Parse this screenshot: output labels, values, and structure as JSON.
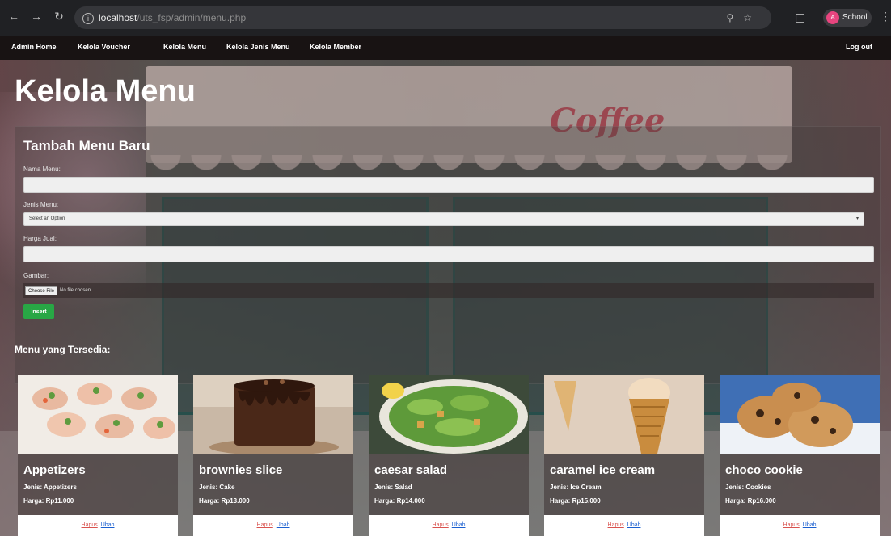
{
  "browser": {
    "url_host": "localhost",
    "url_path": "/uts_fsp/admin/menu.php",
    "profile_name": "School",
    "profile_initial": "A"
  },
  "nav": {
    "items": [
      {
        "label": "Admin Home"
      },
      {
        "label": "Kelola Voucher"
      },
      {
        "label": "Kelola Menu"
      },
      {
        "label": "Kelola Jenis Menu"
      },
      {
        "label": "Kelola Member"
      }
    ],
    "logout_label": "Log out"
  },
  "page": {
    "title": "Kelola Menu",
    "background_sign": "Coffee"
  },
  "form": {
    "heading": "Tambah Menu Baru",
    "nama_label": "Nama Menu:",
    "nama_value": "",
    "jenis_label": "Jenis Menu:",
    "jenis_selected": "Select an Option",
    "harga_label": "Harga Jual:",
    "harga_value": "",
    "gambar_label": "Gambar:",
    "file_button": "Choose File",
    "file_status": "No file chosen",
    "submit_label": "Insert"
  },
  "menu_section": {
    "heading": "Menu yang Tersedia:",
    "delete_label": "Hapus",
    "edit_label": "Ubah",
    "items": [
      {
        "name": "Appetizers",
        "jenis": "Jenis: Appetizers",
        "harga": "Harga: Rp11.000"
      },
      {
        "name": "brownies slice",
        "jenis": "Jenis: Cake",
        "harga": "Harga: Rp13.000"
      },
      {
        "name": "caesar salad",
        "jenis": "Jenis: Salad",
        "harga": "Harga: Rp14.000"
      },
      {
        "name": "caramel ice cream",
        "jenis": "Jenis: Ice Cream",
        "harga": "Harga: Rp15.000"
      },
      {
        "name": "choco cookie",
        "jenis": "Jenis: Cookies",
        "harga": "Harga: Rp16.000"
      }
    ]
  },
  "colors": {
    "nav_bg": "#181313",
    "insert_button": "#28a745",
    "delete_link": "#d9534f",
    "edit_link": "#1a5fd0"
  }
}
